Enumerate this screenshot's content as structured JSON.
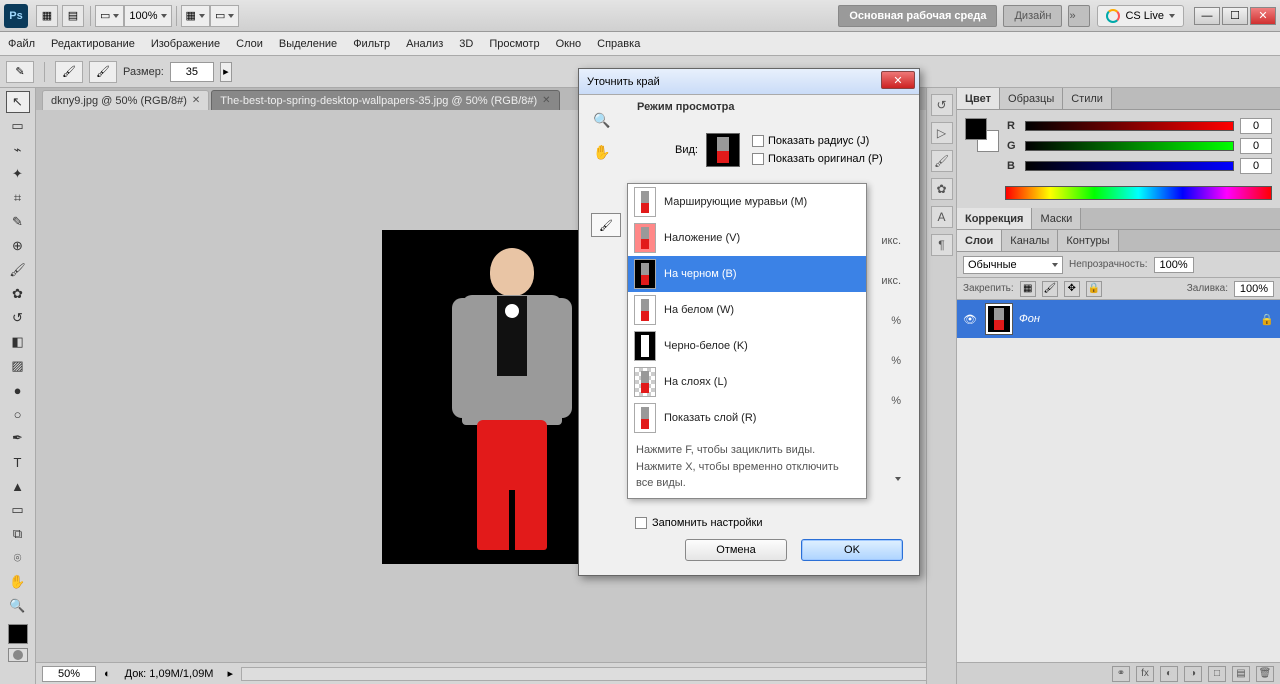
{
  "titlebar": {
    "zoom_pct": "100%",
    "workspace_active": "Основная рабочая среда",
    "workspace_design": "Дизайн",
    "cslive": "CS Live"
  },
  "menus": [
    "Файл",
    "Редактирование",
    "Изображение",
    "Слои",
    "Выделение",
    "Фильтр",
    "Анализ",
    "3D",
    "Просмотр",
    "Окно",
    "Справка"
  ],
  "options": {
    "size_label": "Размер:",
    "size_value": "35"
  },
  "tabs": {
    "active": "dkny9.jpg @ 50% (RGB/8#)",
    "inactive": "The-best-top-spring-desktop-wallpapers-35.jpg @ 50% (RGB/8#)"
  },
  "status": {
    "zoom": "50%",
    "doc": "Док: 1,09M/1,09M"
  },
  "color_panel": {
    "tabs": [
      "Цвет",
      "Образцы",
      "Стили"
    ],
    "r": "0",
    "g": "0",
    "b": "0"
  },
  "adjust_panel": {
    "tabs": [
      "Коррекция",
      "Маски"
    ]
  },
  "layers_panel": {
    "tabs": [
      "Слои",
      "Каналы",
      "Контуры"
    ],
    "blend_mode": "Обычные",
    "opacity_label": "Непрозрачность:",
    "opacity_val": "100%",
    "lock_label": "Закрепить:",
    "fill_label": "Заливка:",
    "fill_val": "100%",
    "layer_name": "Фон"
  },
  "dialog": {
    "title": "Уточнить край",
    "view_mode_header": "Режим просмотра",
    "view_label": "Вид:",
    "show_radius": "Показать радиус (J)",
    "show_original": "Показать оригинал (P)",
    "items": [
      "Марширующие муравьи (M)",
      "Наложение (V)",
      "На черном (B)",
      "На белом (W)",
      "Черно-белое (K)",
      "На слоях (L)",
      "Показать слой (R)"
    ],
    "hint1": "Нажмите F, чтобы зациклить виды.",
    "hint2": "Нажмите X, чтобы временно отключить все виды.",
    "remember": "Запомнить настройки",
    "cancel": "Отмена",
    "ok": "OK",
    "side_unit1": "икс.",
    "side_unit2": "икс.",
    "side_pct1": "%",
    "side_pct2": "%",
    "side_pct3": "%"
  }
}
